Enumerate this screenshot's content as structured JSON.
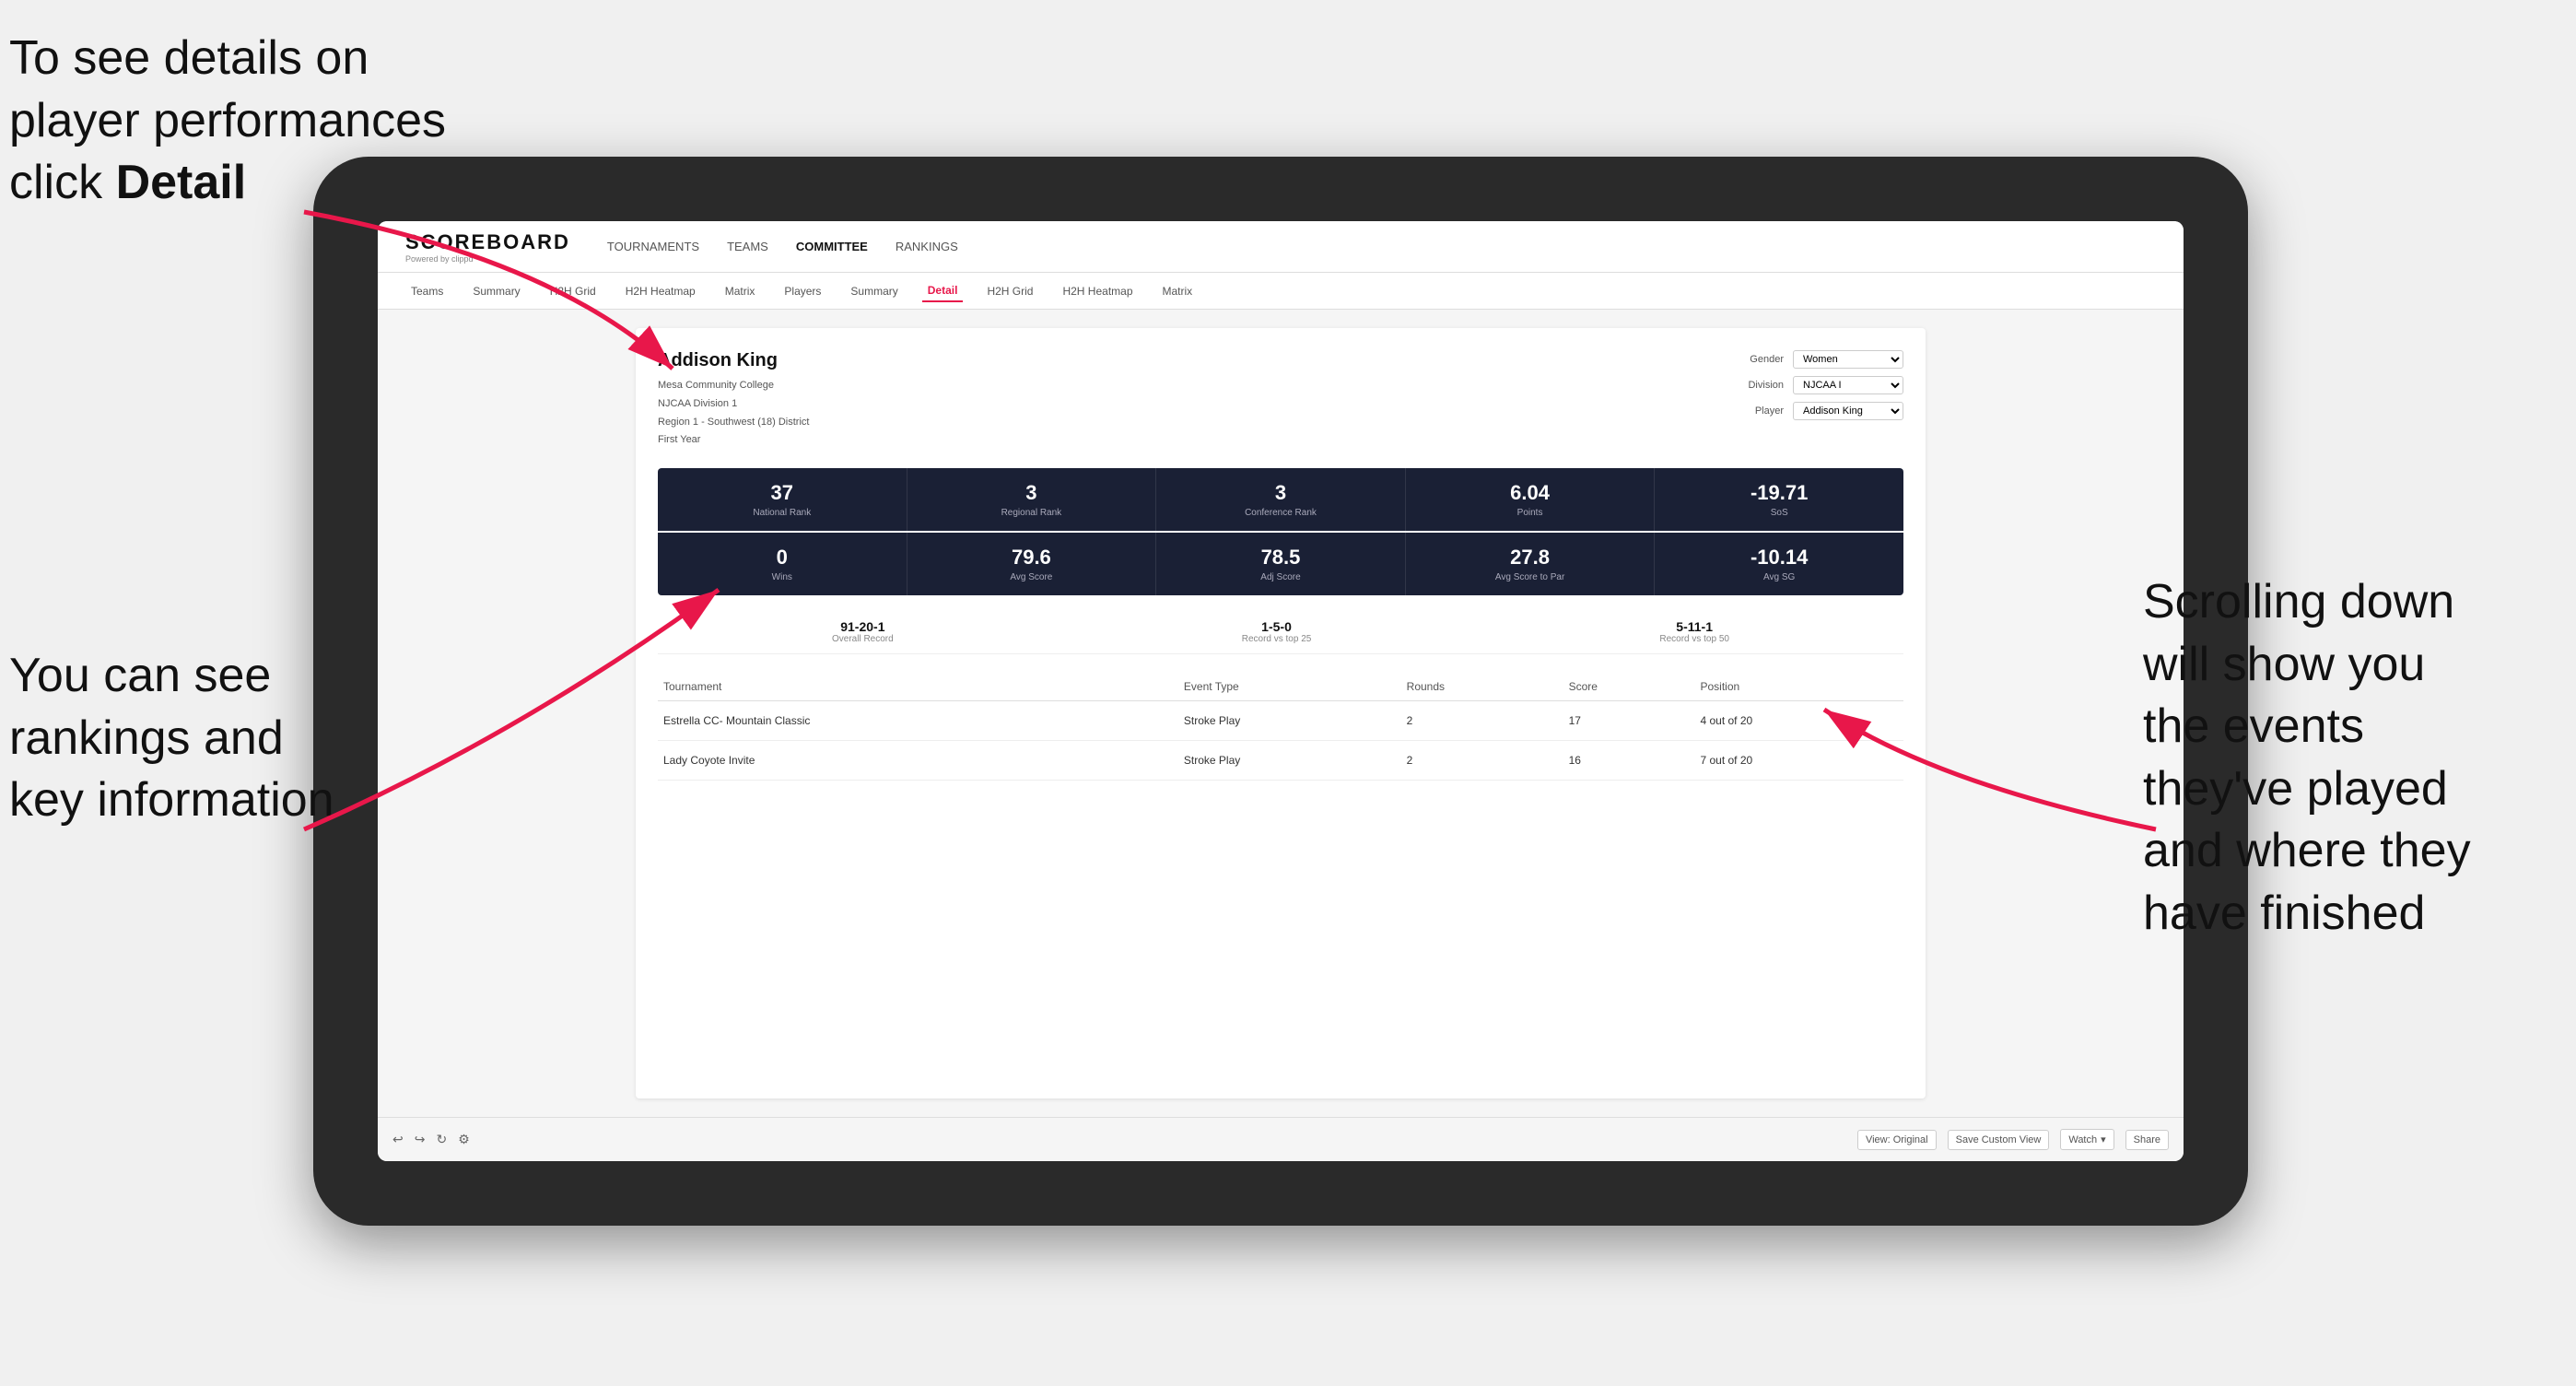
{
  "annotations": {
    "top_left": {
      "line1": "To see details on",
      "line2": "player performances",
      "line3_prefix": "click ",
      "line3_bold": "Detail"
    },
    "bottom_left": {
      "line1": "You can see",
      "line2": "rankings and",
      "line3": "key information"
    },
    "right": {
      "line1": "Scrolling down",
      "line2": "will show you",
      "line3": "the events",
      "line4": "they've played",
      "line5": "and where they",
      "line6": "have finished"
    }
  },
  "header": {
    "logo": "SCOREBOARD",
    "logo_sub": "Powered by clippd",
    "nav": [
      {
        "label": "TOURNAMENTS",
        "active": false
      },
      {
        "label": "TEAMS",
        "active": false
      },
      {
        "label": "COMMITTEE",
        "active": true
      },
      {
        "label": "RANKINGS",
        "active": false
      }
    ]
  },
  "sub_nav": [
    {
      "label": "Teams",
      "active": false
    },
    {
      "label": "Summary",
      "active": false
    },
    {
      "label": "H2H Grid",
      "active": false
    },
    {
      "label": "H2H Heatmap",
      "active": false
    },
    {
      "label": "Matrix",
      "active": false
    },
    {
      "label": "Players",
      "active": false
    },
    {
      "label": "Summary",
      "active": false
    },
    {
      "label": "Detail",
      "active": true
    },
    {
      "label": "H2H Grid",
      "active": false
    },
    {
      "label": "H2H Heatmap",
      "active": false
    },
    {
      "label": "Matrix",
      "active": false
    }
  ],
  "player": {
    "name": "Addison King",
    "school": "Mesa Community College",
    "division": "NJCAA Division 1",
    "region": "Region 1 - Southwest (18) District",
    "year": "First Year"
  },
  "filters": {
    "gender_label": "Gender",
    "gender_value": "Women",
    "division_label": "Division",
    "division_value": "NJCAA I",
    "player_label": "Player",
    "player_value": "Addison King"
  },
  "stats_row1": [
    {
      "value": "37",
      "label": "National Rank"
    },
    {
      "value": "3",
      "label": "Regional Rank"
    },
    {
      "value": "3",
      "label": "Conference Rank"
    },
    {
      "value": "6.04",
      "label": "Points"
    },
    {
      "value": "-19.71",
      "label": "SoS"
    }
  ],
  "stats_row2": [
    {
      "value": "0",
      "label": "Wins"
    },
    {
      "value": "79.6",
      "label": "Avg Score"
    },
    {
      "value": "78.5",
      "label": "Adj Score"
    },
    {
      "value": "27.8",
      "label": "Avg Score to Par"
    },
    {
      "value": "-10.14",
      "label": "Avg SG"
    }
  ],
  "records": [
    {
      "value": "91-20-1",
      "label": "Overall Record"
    },
    {
      "value": "1-5-0",
      "label": "Record vs top 25"
    },
    {
      "value": "5-11-1",
      "label": "Record vs top 50"
    }
  ],
  "table": {
    "headers": [
      "Tournament",
      "Event Type",
      "Rounds",
      "Score",
      "Position"
    ],
    "rows": [
      {
        "tournament": "Estrella CC- Mountain Classic",
        "event_type": "Stroke Play",
        "rounds": "2",
        "score": "17",
        "position": "4 out of 20"
      },
      {
        "tournament": "Lady Coyote Invite",
        "event_type": "Stroke Play",
        "rounds": "2",
        "score": "16",
        "position": "7 out of 20"
      }
    ]
  },
  "toolbar": {
    "view_original": "View: Original",
    "save_custom": "Save Custom View",
    "watch": "Watch",
    "share": "Share"
  }
}
